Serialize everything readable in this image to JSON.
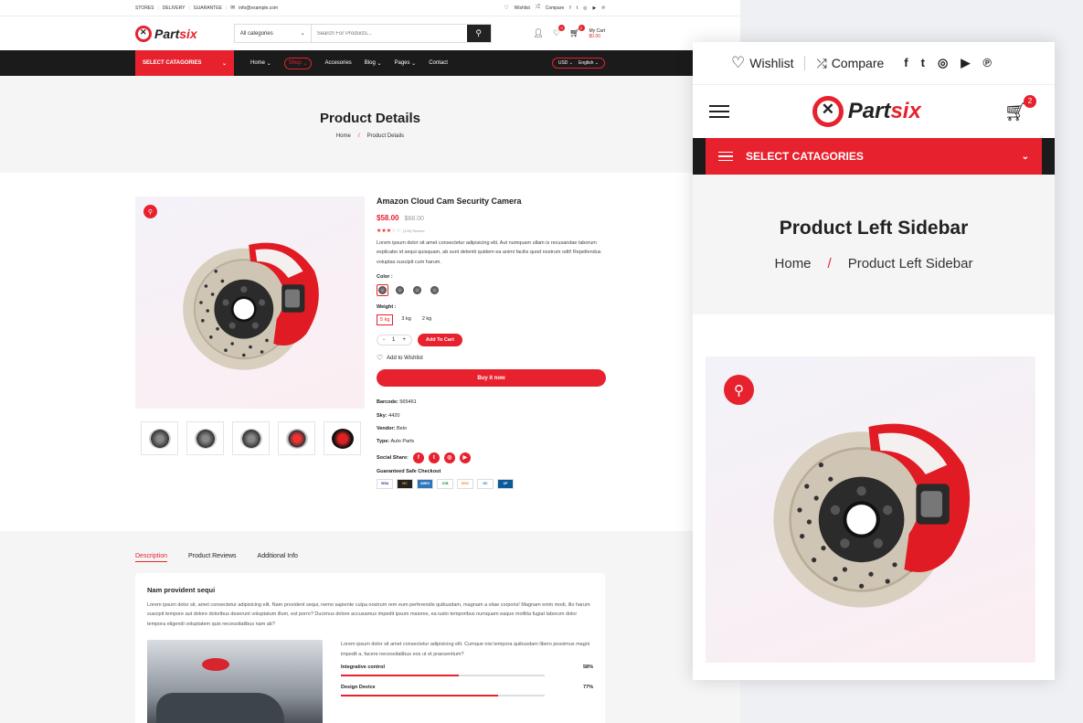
{
  "topbar": {
    "links": [
      "STORES",
      "DELIVERY",
      "GUARANTEE"
    ],
    "email": "info@example.com",
    "wishlist": "Wishlist",
    "compare": "Compare"
  },
  "brand": {
    "part1": "Part",
    "part2": "six"
  },
  "search": {
    "category": "All categories",
    "placeholder": "Search For Products..."
  },
  "header": {
    "wishlist_count": "0",
    "cart_count": "0",
    "cart_label": "My Cart",
    "cart_total": "$0.00"
  },
  "nav": {
    "categories": "SELECT CATAGORIES",
    "items": [
      "Home",
      "Shop",
      "Accesories",
      "Blog",
      "Pages",
      "Contact"
    ],
    "currency": "USD",
    "language": "English"
  },
  "page": {
    "title": "Product Details",
    "crumb_home": "Home",
    "crumb_current": "Product Details"
  },
  "product": {
    "name": "Amazon Cloud Cam Security Camera",
    "price": "$58.00",
    "old_price": "$68.00",
    "rating": 3,
    "reviews": "(126) Review",
    "description": "Lorem ipsum dolor sit amet consectetur adipisicing elit. Aut numquam ullam is recusandae laborum explicabo id sequi quisquam, ab sunt deleniti quidem ea animi facilis quod nostrum odit! Repellendus voluptas suscipit cum harum.",
    "color_label": "Color :",
    "weight_label": "Weight :",
    "weights": [
      "5 kg",
      "3 kg",
      "2 kg"
    ],
    "qty": "1",
    "add_to_cart": "Add To Cart",
    "add_wishlist": "Add to Wishlist",
    "buy_now": "Buy it now",
    "barcode_label": "Barcode:",
    "barcode": "565461",
    "sky_label": "Sky:",
    "sky": "4420",
    "vendor_label": "Vendor:",
    "vendor": "Belo",
    "type_label": "Type:",
    "type": "Auto Parts",
    "social_label": "Social Share:",
    "checkout_label": "Guaranteed Safe Checkout",
    "cards": [
      "VISA",
      "MC",
      "AMEX",
      "JCB",
      "DISC",
      "DC",
      "UP"
    ]
  },
  "tabs": {
    "items": [
      "Description",
      "Product Reviews",
      "Additional Info"
    ],
    "heading": "Nam provident sequi",
    "para": "Lorem ipsum dolor sit, amet consectetur adipisicing elit. Nam provident sequi, nemo sapiente culpa nostrum rem eum perferendis quibusdam, magnam a vitae corporis! Magnam enim modi, illo harum suscipit tempore aut dolore doloribus deserunt voluptatum illum, est porro? Ducimus dolore accusamus impedit ipsum maiores, ea iusto temporibus numquam eaque mollitia fugiat laborum dolor tempora eligendi voluptatem quis necessitatibus nam ab?",
    "para2": "Lorem ipsum dolor sit amet consectetur adipisicing elit. Cumque nisi tempora quibusdam libero possimus magni impedit a, facere necessitatibus eos ut et praesentium?",
    "bars": [
      {
        "label": "Integrative control",
        "value": "58%",
        "pct": 58
      },
      {
        "label": "Design Device",
        "value": "77%",
        "pct": 77
      }
    ]
  },
  "mobile": {
    "wishlist": "Wishlist",
    "compare": "Compare",
    "cart_count": "2",
    "categories": "SELECT CATAGORIES",
    "title": "Product Left Sidebar",
    "crumb_home": "Home",
    "crumb_current": "Product Left Sidebar"
  },
  "colors": {
    "accent": "#e7222e",
    "dark": "#1b1b1b"
  }
}
